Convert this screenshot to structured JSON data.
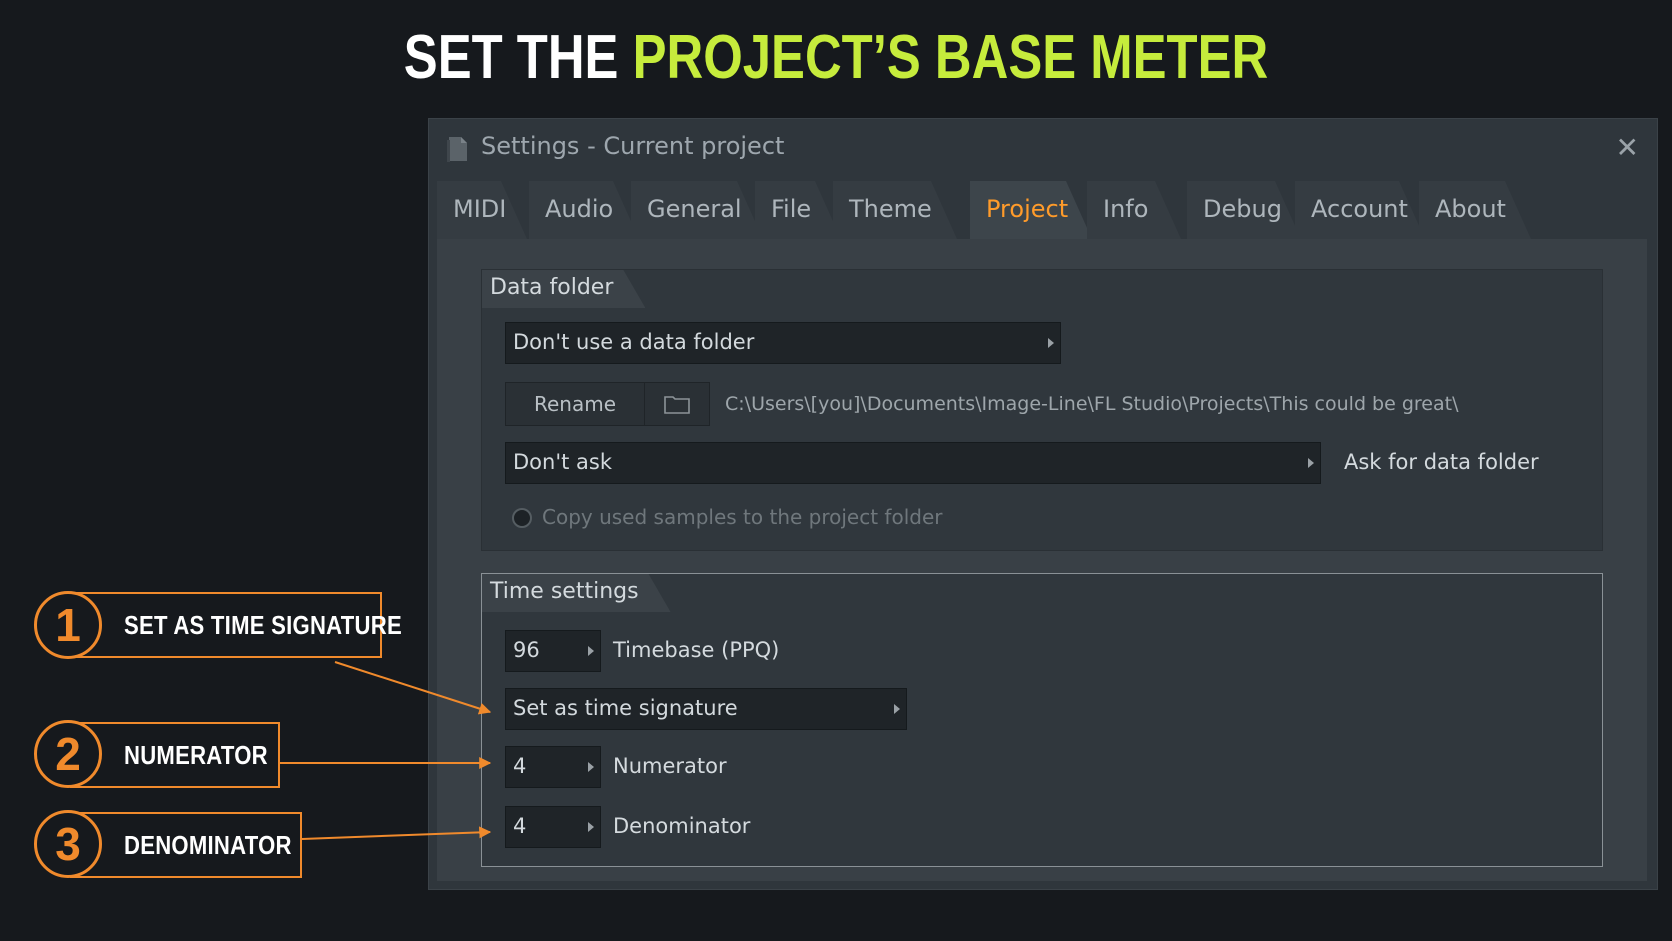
{
  "headline": {
    "part1": "SET THE",
    "part2": "PROJECT’S BASE METER"
  },
  "window": {
    "title": "Settings - Current project",
    "close_icon": "close-icon",
    "doc_icon": "document-icon"
  },
  "tabs": [
    {
      "label": "MIDI",
      "active": false
    },
    {
      "label": "Audio",
      "active": false
    },
    {
      "label": "General",
      "active": false
    },
    {
      "label": "File",
      "active": false
    },
    {
      "label": "Theme",
      "active": false
    },
    {
      "label": "Project",
      "active": true
    },
    {
      "label": "Info",
      "active": false
    },
    {
      "label": "Debug",
      "active": false
    },
    {
      "label": "Account",
      "active": false
    },
    {
      "label": "About",
      "active": false
    }
  ],
  "data_folder": {
    "title": "Data folder",
    "mode": "Don't use a data folder",
    "rename_label": "Rename",
    "folder_icon": "folder-icon",
    "path": "C:\\Users\\[you]\\Documents\\Image-Line\\FL Studio\\Projects\\This could be great\\",
    "ask_value": "Don't ask",
    "ask_label": "Ask for data folder",
    "copy_samples_label": "Copy used samples to the project folder"
  },
  "time_settings": {
    "title": "Time settings",
    "timebase_value": "96",
    "timebase_label": "Timebase (PPQ)",
    "signature_mode": "Set as time signature",
    "numerator_value": "4",
    "numerator_label": "Numerator",
    "denominator_value": "4",
    "denominator_label": "Denominator"
  },
  "annotations": [
    {
      "number": "1",
      "label": "SET AS TIME SIGNATURE"
    },
    {
      "number": "2",
      "label": "NUMERATOR"
    },
    {
      "number": "3",
      "label": "DENOMINATOR"
    }
  ],
  "colors": {
    "accent_lime": "#c6ec3c",
    "accent_orange": "#f08a2c",
    "active_tab": "#ff9b2a"
  }
}
